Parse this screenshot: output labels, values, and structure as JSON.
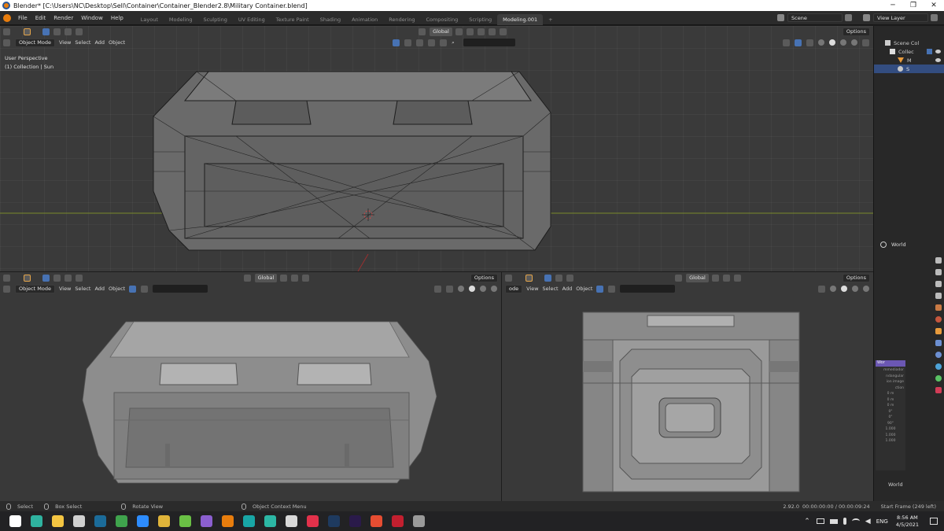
{
  "window": {
    "title": "Blender* [C:\\Users\\NC\\Desktop\\Sell\\Container\\Container_Blender2.8\\Military Container.blend]",
    "minimize": "─",
    "maximize": "❐",
    "close": "✕"
  },
  "menu": [
    "File",
    "Edit",
    "Render",
    "Window",
    "Help"
  ],
  "workspaces": [
    {
      "label": "Layout",
      "active": false
    },
    {
      "label": "Modeling",
      "active": false
    },
    {
      "label": "Sculpting",
      "active": false
    },
    {
      "label": "UV Editing",
      "active": false
    },
    {
      "label": "Texture Paint",
      "active": false
    },
    {
      "label": "Shading",
      "active": false
    },
    {
      "label": "Animation",
      "active": false
    },
    {
      "label": "Rendering",
      "active": false
    },
    {
      "label": "Compositing",
      "active": false
    },
    {
      "label": "Scripting",
      "active": false
    },
    {
      "label": "Modeling.001",
      "active": true
    }
  ],
  "add_workspace": "+",
  "scene": {
    "label": "Scene",
    "view_layer": "View Layer"
  },
  "viewport_top": {
    "transform": "Global",
    "options": "Options",
    "mode": "Object Mode",
    "menus": [
      "View",
      "Select",
      "Add",
      "Object"
    ],
    "overlay_line1": "User Perspective",
    "overlay_line2": "(1) Collection | Sun"
  },
  "viewport_bl": {
    "transform": "Global",
    "options": "Options",
    "mode": "Object Mode",
    "menus": [
      "View",
      "Select",
      "Add",
      "Object"
    ]
  },
  "viewport_br": {
    "transform": "Global",
    "options": "Options",
    "mode": "ode",
    "menus": [
      "View",
      "Select",
      "Add",
      "Object"
    ]
  },
  "outliner": {
    "items": [
      {
        "label": "Scene Col"
      },
      {
        "label": "Collec"
      },
      {
        "label": "M"
      },
      {
        "label": "S"
      }
    ]
  },
  "properties": {
    "world_label": "World",
    "world_footer": "World",
    "node_title": "Wor",
    "node_rows": [
      "mmediador",
      "ndangular",
      "ion image",
      "ction",
      "0 m",
      "0 m",
      "0 m",
      "0°",
      "0°",
      "90°",
      "1.000",
      "1.000",
      "1.000"
    ]
  },
  "status": {
    "select": "Select",
    "box_select": "Box Select",
    "rotate_view": "Rotate View",
    "context_menu": "Object Context Menu",
    "version": "2.92.0",
    "time": "00:00:00:00 / 00:00:09:24",
    "frame": "Start Frame (249 left)"
  },
  "taskbar": {
    "lang": "ENG",
    "clock_time": "8:56 AM",
    "clock_date": "4/5/2021",
    "apps": [
      {
        "name": "windows-icon",
        "color": "#ffffff"
      },
      {
        "name": "edge-icon",
        "color": "#2fb3a0"
      },
      {
        "name": "explorer-icon",
        "color": "#f4c542"
      },
      {
        "name": "github-icon",
        "color": "#d0d0d0"
      },
      {
        "name": "steam-icon",
        "color": "#1b6b9a"
      },
      {
        "name": "xbox-icon",
        "color": "#3fa34d"
      },
      {
        "name": "zoom-icon",
        "color": "#2d8cff"
      },
      {
        "name": "chrome-icon",
        "color": "#e0b43a"
      },
      {
        "name": "pycharm-icon",
        "color": "#6ac045"
      },
      {
        "name": "visual-studio-icon",
        "color": "#8b5fd0"
      },
      {
        "name": "blender-icon",
        "color": "#e87d0d"
      },
      {
        "name": "3dsmax-icon",
        "color": "#18a6a6"
      },
      {
        "name": "maya-icon",
        "color": "#2cb7a5"
      },
      {
        "name": "photos-icon",
        "color": "#d9d9d9"
      },
      {
        "name": "ai-app-icon",
        "color": "#e2314b"
      },
      {
        "name": "photoshop-icon",
        "color": "#1e3a5f"
      },
      {
        "name": "premiere-icon",
        "color": "#2a1a4a"
      },
      {
        "name": "substance-painter-icon",
        "color": "#e64d32"
      },
      {
        "name": "substance-designer-icon",
        "color": "#c21f2f"
      },
      {
        "name": "mixer-icon",
        "color": "#9a9a9a"
      }
    ]
  }
}
